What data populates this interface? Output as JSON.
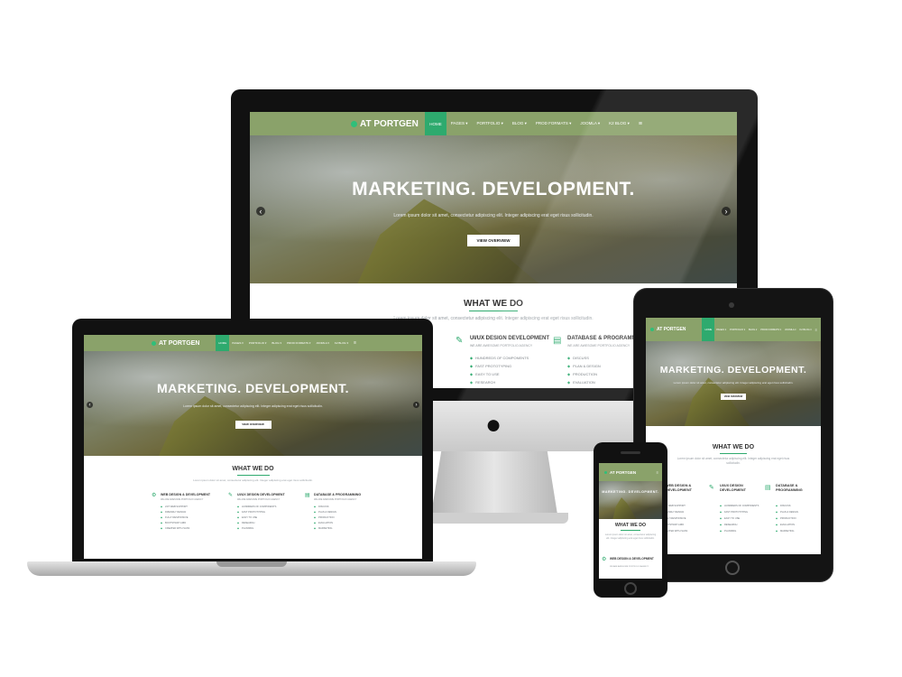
{
  "site": {
    "logo": "AT PORTGEN",
    "nav": [
      "HOME",
      "PAGES ▾",
      "PORTFOLIO ▾",
      "BLOG ▾",
      "PROD FORMATS ▾",
      "JOOMLA ▾",
      "K2 BLOG ▾",
      "≡"
    ],
    "hero_title": "MARKETING. DEVELOPMENT.",
    "hero_sub": "Lorem ipsum dolor sit amet, consectetur adipiscing elit. Integer adipiscing erat eget risus sollicitudin.",
    "hero_button": "VIEW OVERVIEW",
    "what_we_do": "WHAT WE DO",
    "intro": "Lorem ipsum dolor sit amet, consectetur adipiscing elit. Integer adipiscing erat eget risus sollicitudin.",
    "services": [
      {
        "title": "WEB DESIGN & DEVELOPMENT",
        "sub": "WE ARE AWESOME PORTFOLIO AGENCY",
        "icon": "⚙",
        "items": [
          "24/7 WEB SUPPORT",
          "FRIENDLY DESIGN",
          "FULLY RESPONSIVE",
          "BOOTSTRAP GRID",
          "CREATED WITH SASS"
        ]
      },
      {
        "title": "UI/UX DESIGN DEVELOPMENT",
        "sub": "WE ARE AWESOME PORTFOLIO AGENCY",
        "icon": "✎",
        "items": [
          "HUNDREDS OF COMPONENTS",
          "FAST PROTOTYPING",
          "EASY TO USE",
          "RESEARCH",
          "PLANNING"
        ]
      },
      {
        "title": "DATABASE & PROGRAMMING",
        "sub": "WE ARE AWESOME PORTFOLIO AGENCY",
        "icon": "▤",
        "items": [
          "DISCUSS",
          "PLAN & DESIGN",
          "PRODUCTION",
          "EVALUATION",
          "MARKETING"
        ]
      }
    ],
    "tablet_services": [
      {
        "title": "WEB DESIGN & DEVELOPMENT"
      },
      {
        "title": "UI/UX DESIGN DEVELOPMENT"
      },
      {
        "title": "DATABASE & PROGRAMMING"
      }
    ],
    "phone_service": "WEB DESIGN & DEVELOPMENT"
  },
  "colors": {
    "nav": "#8aa26a",
    "accent": "#2eaa6e",
    "dark": "#111111"
  },
  "icons": {
    "apple": "",
    "prev": "‹",
    "next": "›"
  }
}
